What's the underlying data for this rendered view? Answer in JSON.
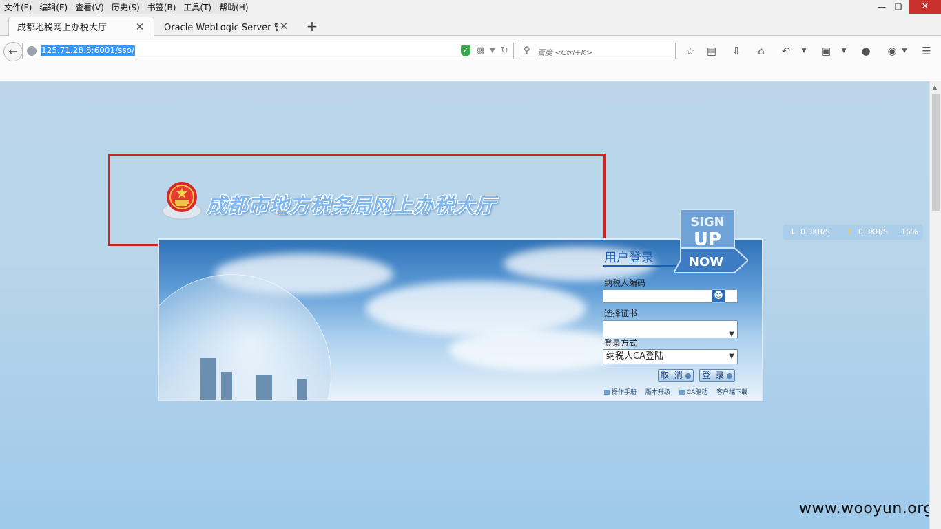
{
  "menu": {
    "items": [
      "文件(F)",
      "编辑(E)",
      "查看(V)",
      "历史(S)",
      "书签(B)",
      "工具(T)",
      "帮助(H)"
    ],
    "window_controls": [
      "minimize",
      "restore",
      "close"
    ]
  },
  "tabs": [
    {
      "title": "成都地税网上办税大厅",
      "active": true
    },
    {
      "title": "Oracle WebLogic Server 管...",
      "active": false
    }
  ],
  "navbar": {
    "url": "125.71.28.8:6001/sso/",
    "search_placeholder": "百度 <Ctrl+K>"
  },
  "page": {
    "site_title": "成都市地方税务局网上办税大厅",
    "signup_badge": {
      "line1": "SIGN",
      "line2": "UP",
      "line3": "NOW"
    },
    "login": {
      "title": "用户登录",
      "taxpayer_label": "纳税人编码",
      "taxpayer_value": "",
      "cert_label": "选择证书",
      "cert_value": "",
      "method_label": "登录方式",
      "method_value": "纳税人CA登陆",
      "cancel_label": "取 消",
      "login_label": "登 录",
      "links": [
        "操作手册",
        "版本升级",
        "CA驱动",
        "客户端下载"
      ]
    },
    "netmeter": {
      "down": "0.3KB/S",
      "up": "0.3KB/S",
      "cpu": "16%"
    },
    "watermark": "www.wooyun.org"
  },
  "colors": {
    "highlight_box": "#d4231c",
    "accent": "#1a5fb4",
    "close_button": "#c7302b"
  }
}
